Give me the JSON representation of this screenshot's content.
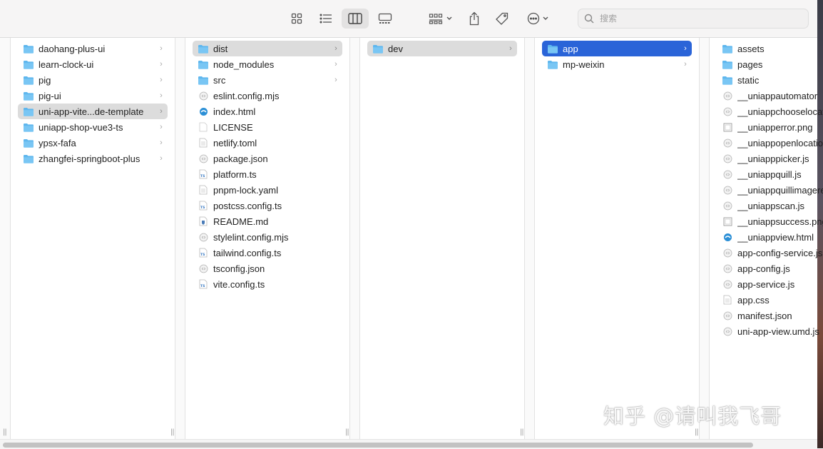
{
  "toolbar": {
    "buttons": [
      "icon-view",
      "list-view",
      "column-view",
      "gallery-view",
      "group-by",
      "share",
      "tags",
      "more-actions"
    ],
    "search_placeholder": "搜索"
  },
  "columns": [
    {
      "items": [
        {
          "name": "daohang-plus-ui",
          "type": "folder",
          "chevron": "›",
          "state": ""
        },
        {
          "name": "learn-clock-ui",
          "type": "folder",
          "chevron": "›",
          "state": ""
        },
        {
          "name": "pig",
          "type": "folder",
          "chevron": "›",
          "state": ""
        },
        {
          "name": "pig-ui",
          "type": "folder",
          "chevron": "›",
          "state": ""
        },
        {
          "name": "uni-app-vite...de-template",
          "type": "folder",
          "chevron": "›",
          "state": "selected-inactive"
        },
        {
          "name": "uniapp-shop-vue3-ts",
          "type": "folder",
          "chevron": "›",
          "state": ""
        },
        {
          "name": "ypsx-fafa",
          "type": "folder",
          "chevron": "›",
          "state": ""
        },
        {
          "name": "zhangfei-springboot-plus",
          "type": "folder",
          "chevron": "›",
          "state": ""
        }
      ]
    },
    {
      "items": [
        {
          "name": "dist",
          "type": "folder",
          "chevron": "›",
          "state": "selected-inactive"
        },
        {
          "name": "node_modules",
          "type": "folder",
          "chevron": "›",
          "state": ""
        },
        {
          "name": "src",
          "type": "folder",
          "chevron": "›",
          "state": ""
        },
        {
          "name": "eslint.config.mjs",
          "type": "js",
          "chevron": "",
          "state": ""
        },
        {
          "name": "index.html",
          "type": "html",
          "chevron": "",
          "state": ""
        },
        {
          "name": "LICENSE",
          "type": "blank",
          "chevron": "",
          "state": ""
        },
        {
          "name": "netlify.toml",
          "type": "doc",
          "chevron": "",
          "state": ""
        },
        {
          "name": "package.json",
          "type": "js",
          "chevron": "",
          "state": ""
        },
        {
          "name": "platform.ts",
          "type": "ts",
          "chevron": "",
          "state": ""
        },
        {
          "name": "pnpm-lock.yaml",
          "type": "text",
          "chevron": "",
          "state": ""
        },
        {
          "name": "postcss.config.ts",
          "type": "ts",
          "chevron": "",
          "state": ""
        },
        {
          "name": "README.md",
          "type": "md",
          "chevron": "",
          "state": ""
        },
        {
          "name": "stylelint.config.mjs",
          "type": "js",
          "chevron": "",
          "state": ""
        },
        {
          "name": "tailwind.config.ts",
          "type": "ts",
          "chevron": "",
          "state": ""
        },
        {
          "name": "tsconfig.json",
          "type": "js",
          "chevron": "",
          "state": ""
        },
        {
          "name": "vite.config.ts",
          "type": "ts",
          "chevron": "",
          "state": ""
        }
      ]
    },
    {
      "items": [
        {
          "name": "dev",
          "type": "folder",
          "chevron": "›",
          "state": "selected-inactive"
        }
      ]
    },
    {
      "items": [
        {
          "name": "app",
          "type": "folder",
          "chevron": "›",
          "state": "selected-active"
        },
        {
          "name": "mp-weixin",
          "type": "folder",
          "chevron": "›",
          "state": ""
        }
      ]
    },
    {
      "items": [
        {
          "name": "assets",
          "type": "folder",
          "chevron": "",
          "state": ""
        },
        {
          "name": "pages",
          "type": "folder",
          "chevron": "",
          "state": ""
        },
        {
          "name": "static",
          "type": "folder",
          "chevron": "",
          "state": ""
        },
        {
          "name": "__uniappautomator",
          "type": "js",
          "chevron": "",
          "state": ""
        },
        {
          "name": "__uniappchooselocation",
          "type": "js",
          "chevron": "",
          "state": ""
        },
        {
          "name": "__uniapperror.png",
          "type": "image",
          "chevron": "",
          "state": ""
        },
        {
          "name": "__uniappopenlocation",
          "type": "js",
          "chevron": "",
          "state": ""
        },
        {
          "name": "__uniapppicker.js",
          "type": "js",
          "chevron": "",
          "state": ""
        },
        {
          "name": "__uniappquill.js",
          "type": "js",
          "chevron": "",
          "state": ""
        },
        {
          "name": "__uniappquillimageresize",
          "type": "js",
          "chevron": "",
          "state": ""
        },
        {
          "name": "__uniappscan.js",
          "type": "js",
          "chevron": "",
          "state": ""
        },
        {
          "name": "__uniappsuccess.png",
          "type": "image",
          "chevron": "",
          "state": ""
        },
        {
          "name": "__uniappview.html",
          "type": "html",
          "chevron": "",
          "state": ""
        },
        {
          "name": "app-config-service.js",
          "type": "js",
          "chevron": "",
          "state": ""
        },
        {
          "name": "app-config.js",
          "type": "js",
          "chevron": "",
          "state": ""
        },
        {
          "name": "app-service.js",
          "type": "js",
          "chevron": "",
          "state": ""
        },
        {
          "name": "app.css",
          "type": "text",
          "chevron": "",
          "state": ""
        },
        {
          "name": "manifest.json",
          "type": "js",
          "chevron": "",
          "state": ""
        },
        {
          "name": "uni-app-view.umd.js",
          "type": "js",
          "chevron": "",
          "state": ""
        }
      ]
    }
  ],
  "resize_handle_glyph": "||",
  "watermark": "知乎 @请叫我飞哥",
  "colors": {
    "folder": "#5fb7ee",
    "selection_active": "#2a64d8",
    "selection_inactive": "#dcdcdc"
  }
}
